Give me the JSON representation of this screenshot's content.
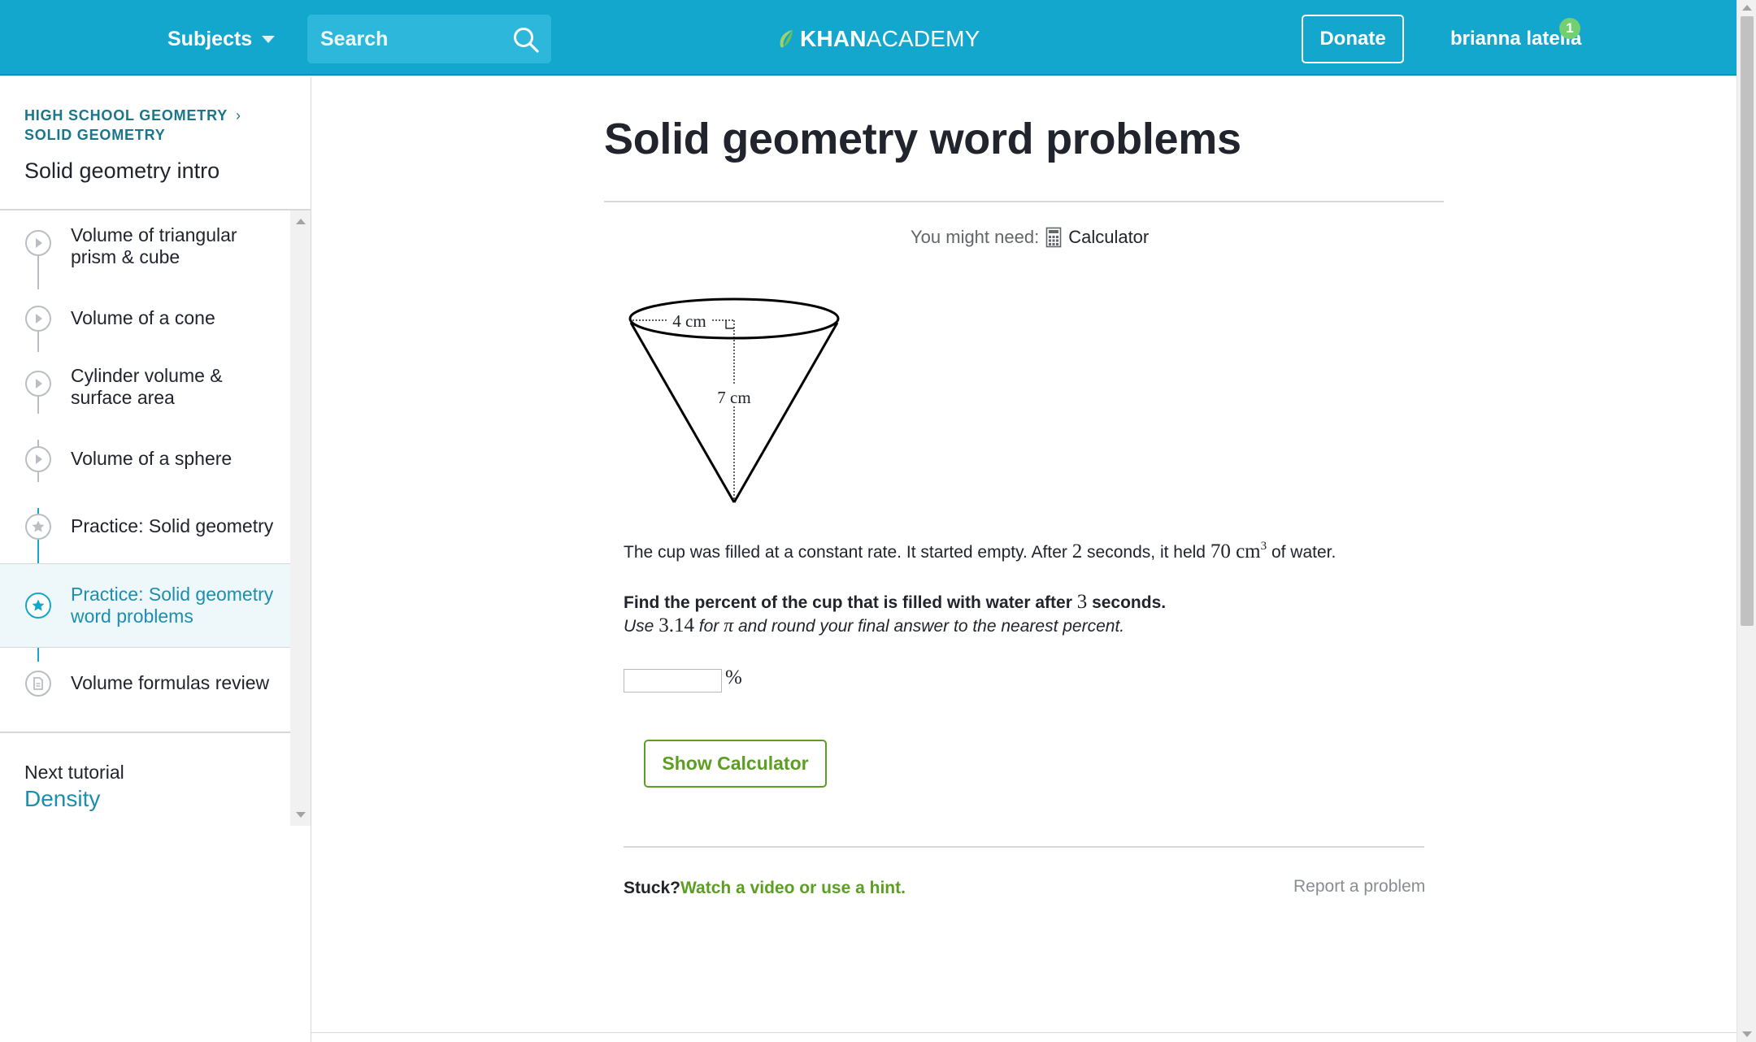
{
  "header": {
    "subjects_label": "Subjects",
    "search_placeholder": "Search",
    "logo_bold": "KHAN",
    "logo_light": "ACADEMY",
    "donate_label": "Donate",
    "user_name": "brianna latella",
    "notification_count": "1",
    "colors": {
      "bar": "#14a7ce",
      "notification": "#74cf70"
    }
  },
  "sidebar": {
    "breadcrumb_course": "HIGH SCHOOL GEOMETRY",
    "breadcrumb_unit": "SOLID GEOMETRY",
    "title": "Solid geometry intro",
    "items": [
      {
        "label_line1": "Volume of triangular",
        "label_line2": "prism & cube",
        "icon": "play-icon",
        "active": false
      },
      {
        "label_line1": "Volume of a cone",
        "label_line2": "",
        "icon": "play-icon",
        "active": false
      },
      {
        "label_line1": "Cylinder volume &",
        "label_line2": "surface area",
        "icon": "play-icon",
        "active": false
      },
      {
        "label_line1": "Volume of a sphere",
        "label_line2": "",
        "icon": "play-icon",
        "active": false
      },
      {
        "label_line1": "Practice: Solid geometry",
        "label_line2": "",
        "icon": "star-icon",
        "active": false
      },
      {
        "label_line1": "Practice: Solid geometry",
        "label_line2": "word problems",
        "icon": "star-icon",
        "active": true
      },
      {
        "label_line1": "Volume formulas review",
        "label_line2": "",
        "icon": "article-icon",
        "active": false
      }
    ],
    "next_label": "Next tutorial",
    "next_link": "Density",
    "colors": {
      "active": "#1c8fae",
      "active_bg": "#eef7f9"
    }
  },
  "main": {
    "title": "Solid geometry word problems",
    "might_need_label": "You might need:",
    "calculator_label": "Calculator",
    "figure": {
      "radius_label": "4 cm",
      "height_label": "7 cm"
    },
    "problem": {
      "part1": "The cup was filled at a constant rate. It started empty. After ",
      "seconds_value": "2",
      "part2": " seconds, it held ",
      "volume_value": "70",
      "volume_unit": "cm",
      "volume_exp": "3",
      "part3": " of water."
    },
    "question": {
      "part1": "Find the percent of the cup that is filled with water after ",
      "seconds_value": "3",
      "part2": " seconds."
    },
    "instruction": {
      "part1": "Use ",
      "pi_value": "3.14",
      "part2": " for ",
      "pi_symbol": "π",
      "part3": " and round your final answer to the nearest percent."
    },
    "answer_value": "",
    "percent_symbol": "%",
    "show_calculator_label": "Show Calculator",
    "stuck_label": "Stuck?",
    "hint_link": "Watch a video or use a hint.",
    "report_label": "Report a problem",
    "colors": {
      "green": "#5c9e22"
    }
  }
}
